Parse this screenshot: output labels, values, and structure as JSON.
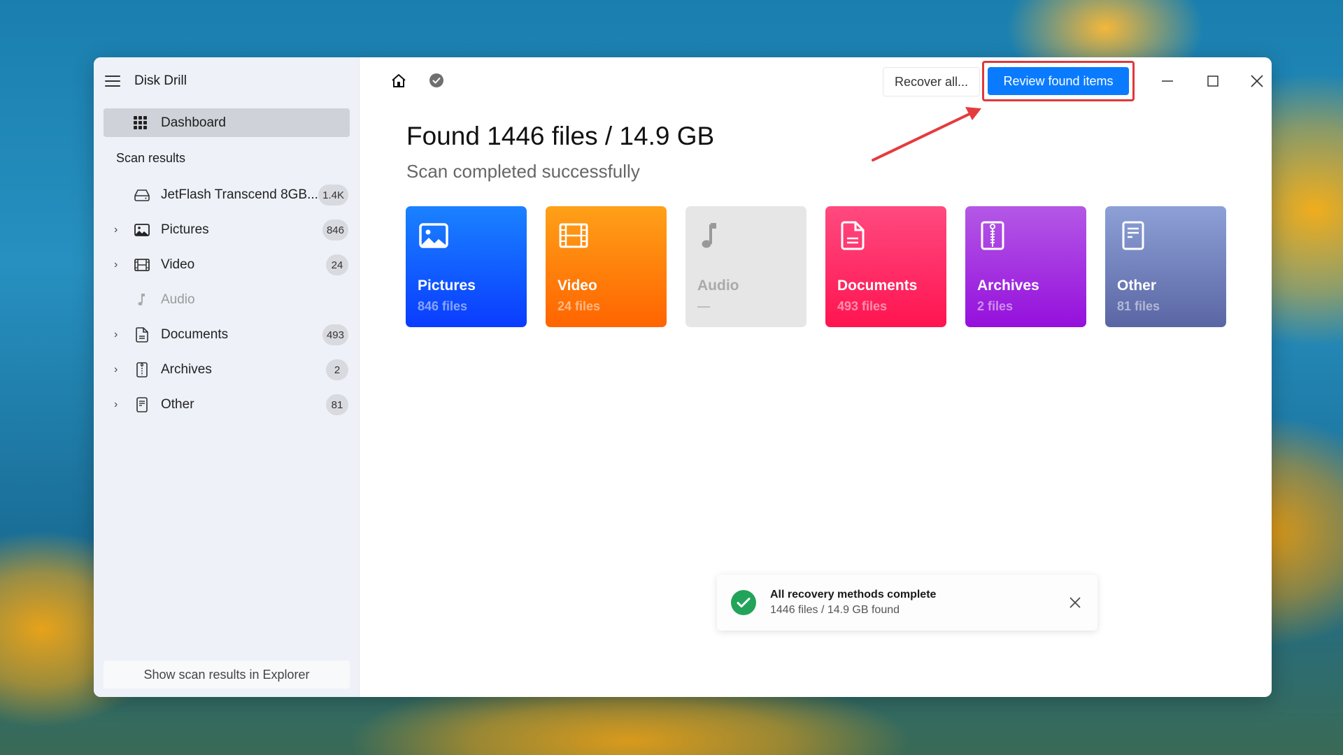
{
  "app": {
    "title": "Disk Drill"
  },
  "sidebar": {
    "dashboard_label": "Dashboard",
    "section_title": "Scan results",
    "items": [
      {
        "label": "JetFlash Transcend 8GB...",
        "badge": "1.4K",
        "icon": "drive-icon",
        "expandable": false,
        "disabled": false
      },
      {
        "label": "Pictures",
        "badge": "846",
        "icon": "picture-icon",
        "expandable": true,
        "disabled": false
      },
      {
        "label": "Video",
        "badge": "24",
        "icon": "film-icon",
        "expandable": true,
        "disabled": false
      },
      {
        "label": "Audio",
        "badge": "",
        "icon": "music-note-icon",
        "expandable": false,
        "disabled": true
      },
      {
        "label": "Documents",
        "badge": "493",
        "icon": "document-icon",
        "expandable": true,
        "disabled": false
      },
      {
        "label": "Archives",
        "badge": "2",
        "icon": "archive-zip-icon",
        "expandable": true,
        "disabled": false
      },
      {
        "label": "Other",
        "badge": "81",
        "icon": "other-file-icon",
        "expandable": true,
        "disabled": false
      }
    ],
    "explorer_button": "Show scan results in Explorer"
  },
  "toolbar": {
    "recover_all": "Recover all...",
    "review_found": "Review found items"
  },
  "main": {
    "headline": "Found 1446 files / 14.9 GB",
    "subline": "Scan completed successfully",
    "cards": [
      {
        "title": "Pictures",
        "count": "846 files"
      },
      {
        "title": "Video",
        "count": "24 files"
      },
      {
        "title": "Audio",
        "count": "—"
      },
      {
        "title": "Documents",
        "count": "493 files"
      },
      {
        "title": "Archives",
        "count": "2 files"
      },
      {
        "title": "Other",
        "count": "81 files"
      }
    ]
  },
  "toast": {
    "title": "All recovery methods complete",
    "subtitle": "1446 files / 14.9 GB found"
  },
  "colors": {
    "accent": "#0a7bff",
    "highlight_annotation": "#e0383b",
    "success": "#22a35a"
  }
}
